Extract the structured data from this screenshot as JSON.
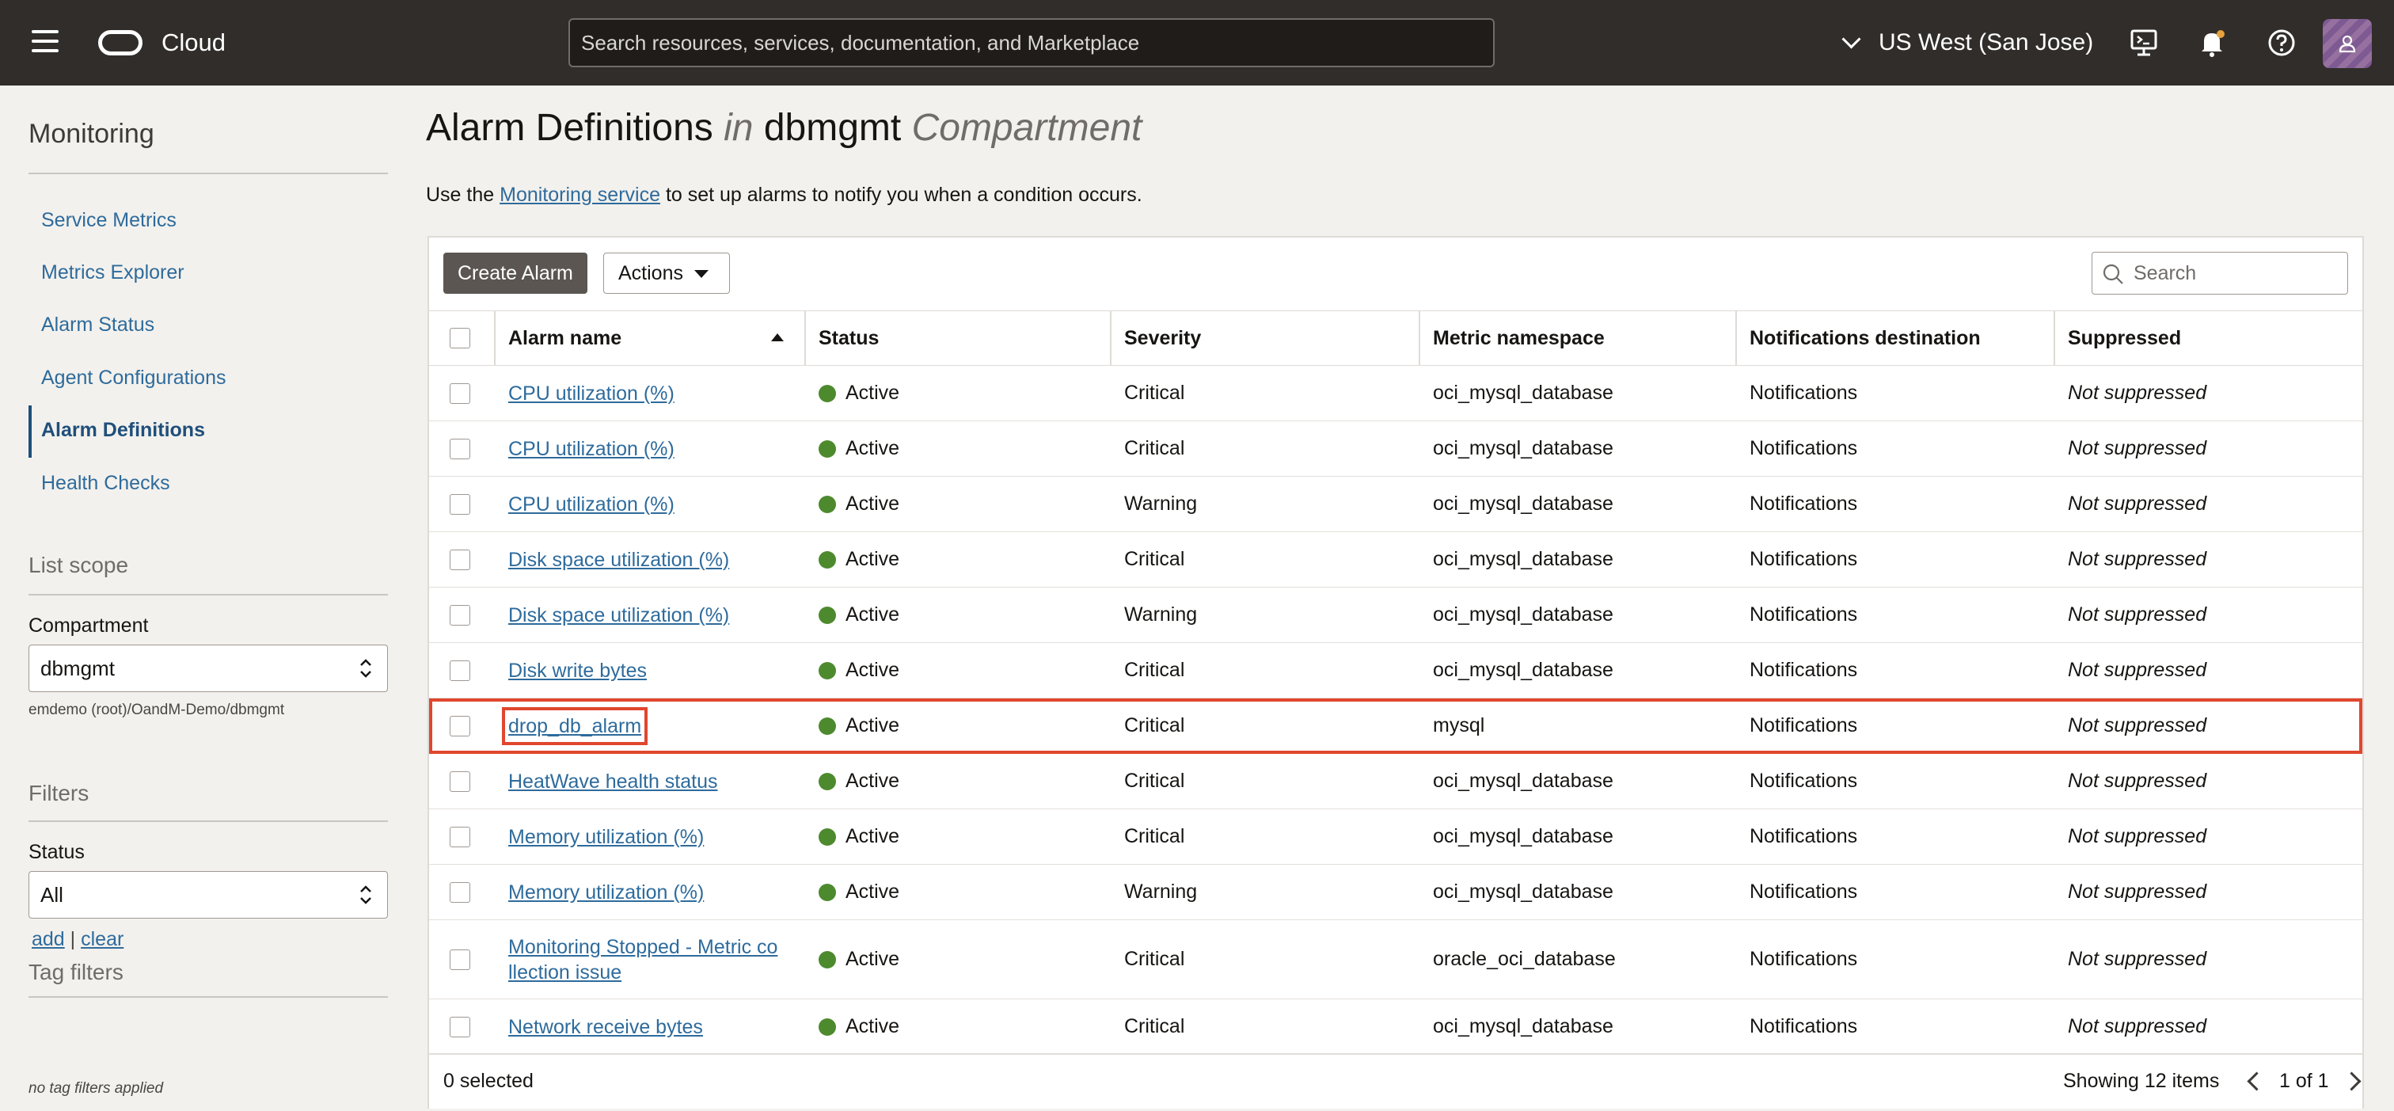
{
  "header": {
    "brand": "Cloud",
    "search_placeholder": "Search resources, services, documentation, and Marketplace",
    "region": "US West (San Jose)"
  },
  "sidebar": {
    "title": "Monitoring",
    "items": [
      {
        "label": "Service Metrics"
      },
      {
        "label": "Metrics Explorer"
      },
      {
        "label": "Alarm Status"
      },
      {
        "label": "Agent Configurations"
      },
      {
        "label": "Alarm Definitions",
        "active": true
      },
      {
        "label": "Health Checks"
      }
    ],
    "list_scope": {
      "title": "List scope",
      "compartment_label": "Compartment",
      "compartment_value": "dbmgmt",
      "compartment_path": "emdemo (root)/OandM-Demo/dbmgmt"
    },
    "filters": {
      "title": "Filters",
      "status_label": "Status",
      "status_value": "All"
    },
    "tag_filters": {
      "title": "Tag filters",
      "add": "add",
      "separator": "|",
      "clear": "clear",
      "note": "no tag filters applied"
    }
  },
  "main": {
    "title": {
      "part1": "Alarm Definitions",
      "part2": "in",
      "part3": "dbmgmt",
      "part4": "Compartment"
    },
    "intro": {
      "before": "Use the",
      "link": "Monitoring service",
      "after": "to set up alarms to notify you when a condition occurs."
    },
    "toolbar": {
      "create": "Create Alarm",
      "actions": "Actions",
      "search_placeholder": "Search"
    },
    "columns": [
      "Alarm name",
      "Status",
      "Severity",
      "Metric namespace",
      "Notifications destination",
      "Suppressed"
    ],
    "rows": [
      {
        "name": "CPU utilization (%)",
        "status": "Active",
        "severity": "Critical",
        "namespace": "oci_mysql_database",
        "destination": "Notifications",
        "suppressed": "Not suppressed"
      },
      {
        "name": "CPU utilization (%)",
        "status": "Active",
        "severity": "Critical",
        "namespace": "oci_mysql_database",
        "destination": "Notifications",
        "suppressed": "Not suppressed"
      },
      {
        "name": "CPU utilization (%)",
        "status": "Active",
        "severity": "Warning",
        "namespace": "oci_mysql_database",
        "destination": "Notifications",
        "suppressed": "Not suppressed"
      },
      {
        "name": "Disk space utilization (%)",
        "status": "Active",
        "severity": "Critical",
        "namespace": "oci_mysql_database",
        "destination": "Notifications",
        "suppressed": "Not suppressed"
      },
      {
        "name": "Disk space utilization (%)",
        "status": "Active",
        "severity": "Warning",
        "namespace": "oci_mysql_database",
        "destination": "Notifications",
        "suppressed": "Not suppressed"
      },
      {
        "name": "Disk write bytes",
        "status": "Active",
        "severity": "Critical",
        "namespace": "oci_mysql_database",
        "destination": "Notifications",
        "suppressed": "Not suppressed"
      },
      {
        "name": "drop_db_alarm",
        "status": "Active",
        "severity": "Critical",
        "namespace": "mysql",
        "destination": "Notifications",
        "suppressed": "Not suppressed"
      },
      {
        "name": "HeatWave health status",
        "status": "Active",
        "severity": "Critical",
        "namespace": "oci_mysql_database",
        "destination": "Notifications",
        "suppressed": "Not suppressed"
      },
      {
        "name": "Memory utilization (%)",
        "status": "Active",
        "severity": "Critical",
        "namespace": "oci_mysql_database",
        "destination": "Notifications",
        "suppressed": "Not suppressed"
      },
      {
        "name": "Memory utilization (%)",
        "status": "Active",
        "severity": "Warning",
        "namespace": "oci_mysql_database",
        "destination": "Notifications",
        "suppressed": "Not suppressed"
      },
      {
        "name_line1": "Monitoring Stopped - Metric co",
        "name_line2": "llection issue",
        "status": "Active",
        "severity": "Critical",
        "namespace": "oracle_oci_database",
        "destination": "Notifications",
        "suppressed": "Not suppressed"
      },
      {
        "name": "Network receive bytes",
        "status": "Active",
        "severity": "Critical",
        "namespace": "oci_mysql_database",
        "destination": "Notifications",
        "suppressed": "Not suppressed"
      }
    ],
    "footer": {
      "selected": "0 selected",
      "showing": "Showing 12 items",
      "page": "1 of 1"
    }
  },
  "colors": {
    "topbar": "#312d2a",
    "link": "#2e6b9c",
    "status_active": "#4d8a2e",
    "highlight": "#e0462e"
  },
  "icons": [
    "hamburger-icon",
    "oracle-logo-icon",
    "chevron-down-icon",
    "cloud-shell-icon",
    "bell-icon",
    "help-icon",
    "user-icon",
    "search-icon",
    "sort-ascending-icon",
    "caret-down-icon",
    "chevron-left-icon",
    "chevron-right-icon"
  ]
}
